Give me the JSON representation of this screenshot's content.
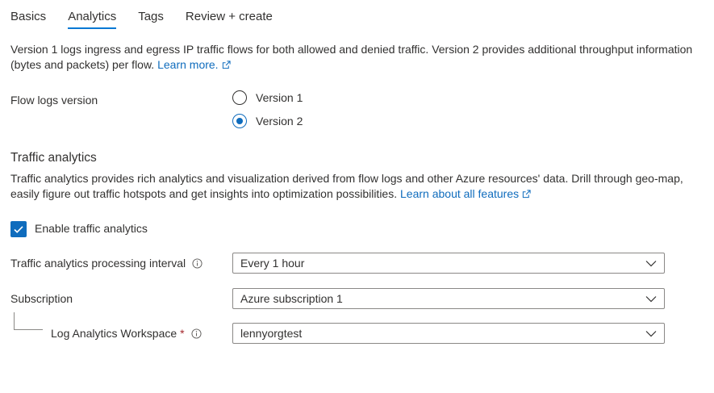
{
  "tabs": [
    {
      "label": "Basics",
      "active": false
    },
    {
      "label": "Analytics",
      "active": true
    },
    {
      "label": "Tags",
      "active": false
    },
    {
      "label": "Review + create",
      "active": false
    }
  ],
  "intro": {
    "text": "Version 1 logs ingress and egress IP traffic flows for both allowed and denied traffic. Version 2 provides additional throughput information (bytes and packets) per flow.",
    "link": "Learn more."
  },
  "flow_logs": {
    "label": "Flow logs version",
    "options": [
      {
        "label": "Version 1",
        "selected": false
      },
      {
        "label": "Version 2",
        "selected": true
      }
    ]
  },
  "traffic_analytics": {
    "title": "Traffic analytics",
    "description": "Traffic analytics provides rich analytics and visualization derived from flow logs and other Azure resources' data. Drill through geo-map, easily figure out traffic hotspots and get insights into optimization possibilities.",
    "link": "Learn about all features",
    "enable_label": "Enable traffic analytics",
    "enabled": true
  },
  "fields": {
    "interval": {
      "label": "Traffic analytics processing interval",
      "value": "Every 1 hour"
    },
    "subscription": {
      "label": "Subscription",
      "value": "Azure subscription 1"
    },
    "workspace": {
      "label": "Log Analytics Workspace",
      "required_mark": "*",
      "value": "lennyorgtest"
    }
  },
  "colors": {
    "accent": "#0f6cbd",
    "tab_underline": "#0078d4",
    "text": "#323130",
    "required": "#a4262c"
  },
  "icons": [
    "external-link-icon",
    "info-icon",
    "chevron-down-icon",
    "checkmark-icon"
  ]
}
